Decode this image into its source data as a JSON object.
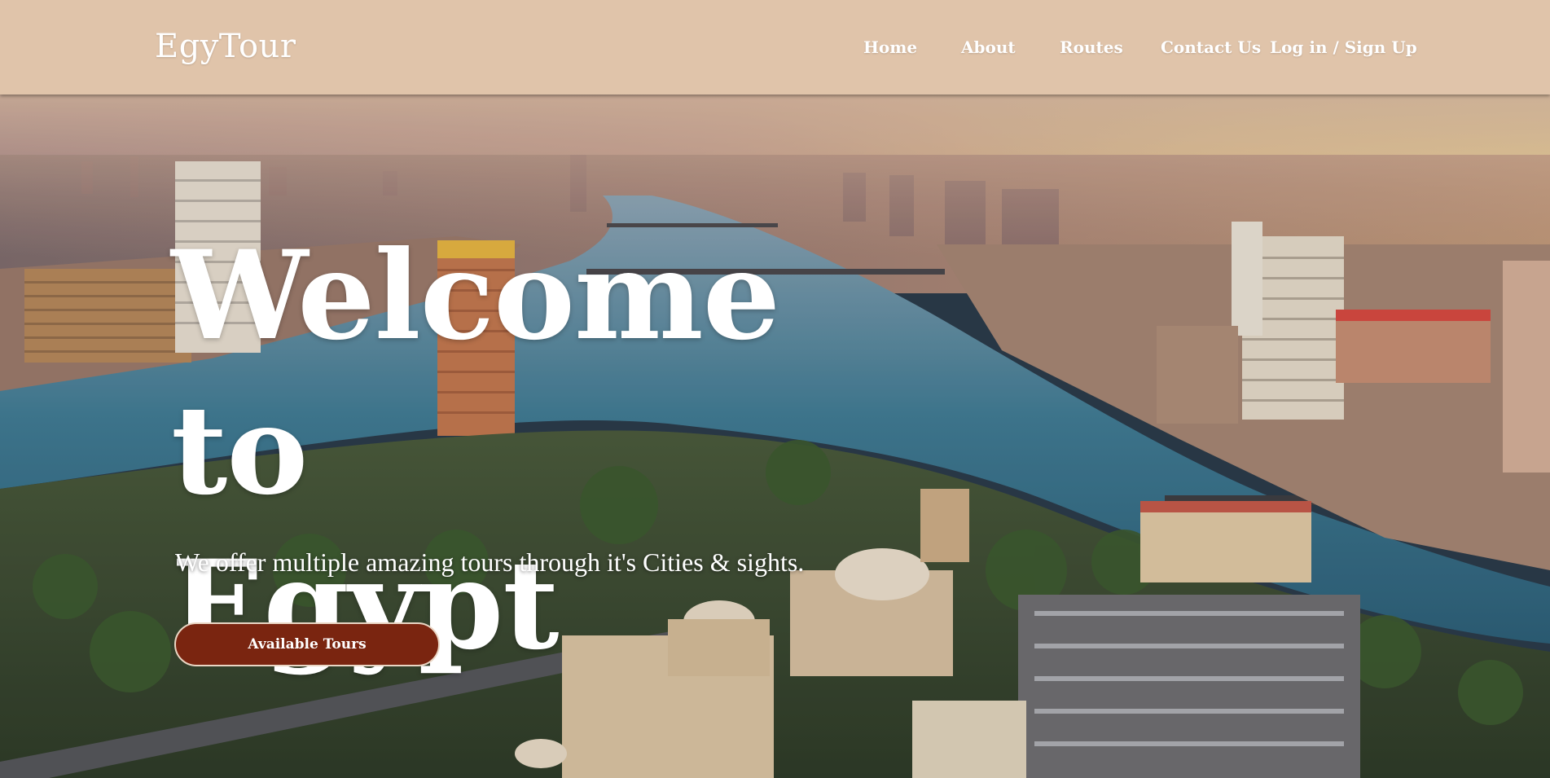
{
  "navbar": {
    "brand": "EgyTour",
    "links": [
      {
        "label": "Home"
      },
      {
        "label": "About"
      },
      {
        "label": "Routes"
      },
      {
        "label": "Contact Us"
      },
      {
        "label": "Log in / Sign Up"
      }
    ],
    "background": "#e0c4aa"
  },
  "hero": {
    "title_line1": "Welcome to",
    "title_line2": "Egypt",
    "subtitle": "We offer multiple amazing tours through it's Cities & sights.",
    "cta_label": "Available Tours",
    "cta_color": "#7a2510",
    "image": "cairo-nile-aerial-skyline"
  }
}
